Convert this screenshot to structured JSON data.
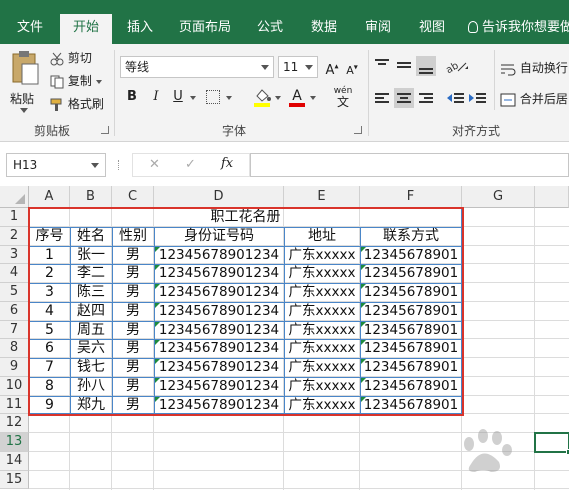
{
  "ribbon_tabs": [
    {
      "label": "文件",
      "active": false
    },
    {
      "label": "开始",
      "active": true
    },
    {
      "label": "插入",
      "active": false
    },
    {
      "label": "页面布局",
      "active": false
    },
    {
      "label": "公式",
      "active": false
    },
    {
      "label": "数据",
      "active": false
    },
    {
      "label": "审阅",
      "active": false
    },
    {
      "label": "视图",
      "active": false
    }
  ],
  "tell_me": "告诉我你想要做",
  "clipboard": {
    "paste": "粘贴",
    "cut": "剪切",
    "copy": "复制",
    "format_painter": "格式刷",
    "group_label": "剪贴板"
  },
  "font": {
    "name": "等线",
    "size": "11",
    "bold": "B",
    "italic": "I",
    "underline": "U",
    "phonetic": "wén",
    "group_label": "字体"
  },
  "alignment": {
    "wrap_text": "自动换行",
    "merge_center": "合并后居",
    "group_label": "对齐方式"
  },
  "formula_bar": {
    "name_box": "H13",
    "cancel": "✕",
    "enter": "✓",
    "fx": "fx",
    "content": ""
  },
  "sheet": {
    "columns": [
      "A",
      "B",
      "C",
      "D",
      "E",
      "F",
      "G"
    ],
    "rows": [
      "1",
      "2",
      "3",
      "4",
      "5",
      "6",
      "7",
      "8",
      "9",
      "10",
      "11",
      "12",
      "13",
      "14",
      "15"
    ],
    "title": "职工花名册",
    "headers": [
      "序号",
      "姓名",
      "性别",
      "身份证号码",
      "地址",
      "联系方式"
    ],
    "records": [
      [
        "1",
        "张一",
        "男",
        "12345678901234",
        "广东xxxxx",
        "12345678901"
      ],
      [
        "2",
        "李二",
        "男",
        "12345678901234",
        "广东xxxxx",
        "12345678901"
      ],
      [
        "3",
        "陈三",
        "男",
        "12345678901234",
        "广东xxxxx",
        "12345678901"
      ],
      [
        "4",
        "赵四",
        "男",
        "12345678901234",
        "广东xxxxx",
        "12345678901"
      ],
      [
        "5",
        "周五",
        "男",
        "12345678901234",
        "广东xxxxx",
        "12345678901"
      ],
      [
        "6",
        "吴六",
        "男",
        "12345678901234",
        "广东xxxxx",
        "12345678901"
      ],
      [
        "7",
        "钱七",
        "男",
        "12345678901234",
        "广东xxxxx",
        "12345678901"
      ],
      [
        "8",
        "孙八",
        "男",
        "12345678901234",
        "广东xxxxx",
        "12345678901"
      ],
      [
        "9",
        "郑九",
        "男",
        "12345678901234",
        "广东xxxxx",
        "12345678901"
      ]
    ],
    "selected_cell": "H13"
  },
  "colors": {
    "ribbon_green": "#217346",
    "table_border": "#4a86c8",
    "highlight_box": "#d9342b",
    "error_triangle": "#1e8a3e"
  },
  "watermark_icon": "baidu-paw-icon"
}
